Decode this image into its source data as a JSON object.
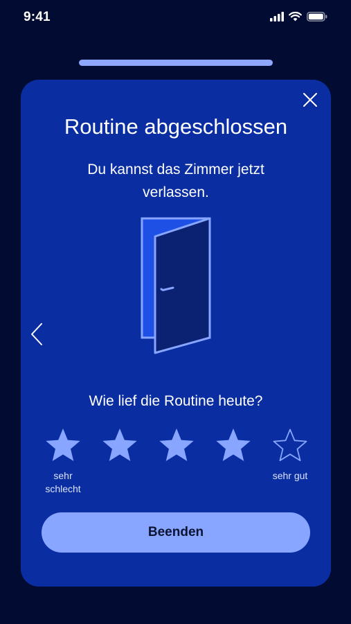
{
  "status_bar": {
    "time": "9:41",
    "icons": [
      "cellular-signal-icon",
      "wifi-icon",
      "battery-icon"
    ]
  },
  "dialog": {
    "title": "Routine abgeschlossen",
    "subtitle": "Du kannst das Zimmer jetzt verlassen.",
    "illustration": "open-door-icon",
    "question": "Wie lief die Routine heute?",
    "rating": {
      "max": 5,
      "selected": 4,
      "low_label": "sehr schlecht",
      "high_label": "sehr gut"
    },
    "finish_button": "Beenden"
  },
  "colors": {
    "background": "#020c33",
    "card": "#0a2ea1",
    "accent": "#88a5ff",
    "star_filled": "#88a5ff",
    "door_frame": "#1e50e6",
    "door_leaf": "#0b2273"
  }
}
